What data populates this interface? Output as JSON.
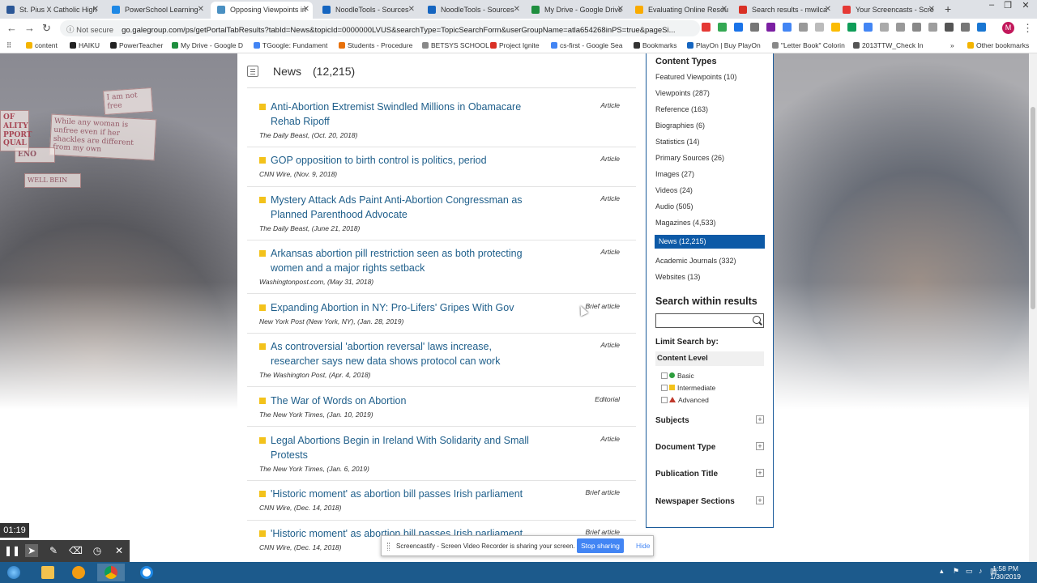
{
  "browser": {
    "tabs": [
      {
        "label": "St. Pius X Catholic High",
        "color": "#2b5797"
      },
      {
        "label": "PowerSchool Learning",
        "color": "#1e88e5"
      },
      {
        "label": "Opposing Viewpoints in",
        "color": "#4a90c2"
      },
      {
        "label": "NoodleTools - Sources",
        "color": "#1565c0"
      },
      {
        "label": "NoodleTools - Sources",
        "color": "#1565c0"
      },
      {
        "label": "My Drive - Google Drive",
        "color": "#1e8e3e"
      },
      {
        "label": "Evaluating Online Resou",
        "color": "#f9ab00"
      },
      {
        "label": "Search results - mwilca",
        "color": "#d93025"
      },
      {
        "label": "Your Screencasts - Scre",
        "color": "#e53935"
      }
    ],
    "new_tab": "+",
    "url_security": "Not secure",
    "url": "go.galegroup.com/ps/getPortalTabResults?tabId=News&topicId=0000000LVUS&searchType=TopicSearchForm&userGroupName=atla654268inPS=true&pageSi...",
    "profile_initial": "M",
    "bookmarks": [
      {
        "label": "content",
        "color": "#f4b400"
      },
      {
        "label": "HAIKU",
        "color": "#222222"
      },
      {
        "label": "PowerTeacher",
        "color": "#222222"
      },
      {
        "label": "My Drive - Google D",
        "color": "#1e8e3e"
      },
      {
        "label": "TGoogle: Fundament",
        "color": "#4285f4"
      },
      {
        "label": "Students - Procedure",
        "color": "#e8710a"
      },
      {
        "label": "BETSYS SCHOOL",
        "color": "#888888"
      },
      {
        "label": "Project Ignite",
        "color": "#d93025"
      },
      {
        "label": "cs-first - Google Sea",
        "color": "#4285f4"
      },
      {
        "label": "Bookmarks",
        "color": "#333333"
      },
      {
        "label": "PlayOn | Buy PlayOn",
        "color": "#1565c0"
      },
      {
        "label": "\"Letter Book\" Colorin",
        "color": "#888888"
      },
      {
        "label": "2013TTW_Check In",
        "color": "#555555"
      },
      {
        "label": "Other bookmarks",
        "color": "#f4b400"
      }
    ],
    "more_bookmarks": "»"
  },
  "background_signs": [
    "I am not free",
    "While any woman is unfree even if her shackles are different from my own",
    "ENO",
    "WELL BEIN",
    "OF ALITY PPORT QUAL"
  ],
  "section": {
    "header": "News",
    "count": "(12,215)"
  },
  "results": [
    {
      "title": "Anti-Abortion Extremist Swindled Millions in Obamacare Rehab Ripoff",
      "source": "The Daily Beast",
      "date": "(Oct. 20, 2018)",
      "type": "Article"
    },
    {
      "title": "GOP opposition to birth control is politics, period",
      "source": "CNN Wire",
      "date": "(Nov. 9, 2018)",
      "type": "Article"
    },
    {
      "title": "Mystery Attack Ads Paint Anti-Abortion Congressman as Planned Parenthood Advocate",
      "source": "The Daily Beast",
      "date": "(June 21, 2018)",
      "type": "Article"
    },
    {
      "title": "Arkansas abortion pill restriction seen as both protecting women and a major rights setback",
      "source": "Washingtonpost.com",
      "date": "(May 31, 2018)",
      "type": "Article"
    },
    {
      "title": "Expanding Abortion in NY: Pro-Lifers' Gripes With Gov",
      "source": "New York Post (New York, NY)",
      "date": "(Jan. 28, 2019)",
      "type": "Brief article"
    },
    {
      "title": "As controversial 'abortion reversal' laws increase, researcher says new data shows protocol can work",
      "source": "The Washington Post",
      "date": "(Apr. 4, 2018)",
      "type": "Article"
    },
    {
      "title": "The War of Words on Abortion",
      "source": "The New York Times",
      "date": "(Jan. 10, 2019)",
      "type": "Editorial"
    },
    {
      "title": "Legal Abortions Begin in Ireland With Solidarity and Small Protests",
      "source": "The New York Times",
      "date": "(Jan. 6, 2019)",
      "type": "Article"
    },
    {
      "title": "'Historic moment' as abortion bill passes Irish parliament",
      "source": "CNN Wire",
      "date": "(Dec. 14, 2018)",
      "type": "Brief article"
    },
    {
      "title": "'Historic moment' as abortion bill passes Irish parliament",
      "source": "CNN Wire",
      "date": "(Dec. 14, 2018)",
      "type": "Brief article"
    }
  ],
  "sidebar": {
    "content_types_heading": "Content Types",
    "content_types": [
      "Featured Viewpoints (10)",
      "Viewpoints (287)",
      "Reference (163)",
      "Biographies (6)",
      "Statistics (14)",
      "Primary Sources (26)",
      "Images (27)",
      "Videos (24)",
      "Audio (505)",
      "Magazines (4,533)",
      "News (12,215)",
      "Academic Journals (332)",
      "Websites (13)"
    ],
    "selected_index": 10,
    "search_heading": "Search within results",
    "search_value": "",
    "limit_heading": "Limit Search by:",
    "content_level_heading": "Content Level",
    "levels": [
      "Basic",
      "Intermediate",
      "Advanced"
    ],
    "facets": [
      "Subjects",
      "Document Type",
      "Publication Title",
      "Newspaper Sections"
    ],
    "expand_symbol": "+"
  },
  "screencastify": {
    "timer": "01:19",
    "share_message": "Screencastify - Screen Video Recorder is sharing your screen.",
    "stop_label": "Stop sharing",
    "hide_label": "Hide"
  },
  "taskbar": {
    "time": "1:58 PM",
    "date": "1/30/2019"
  }
}
